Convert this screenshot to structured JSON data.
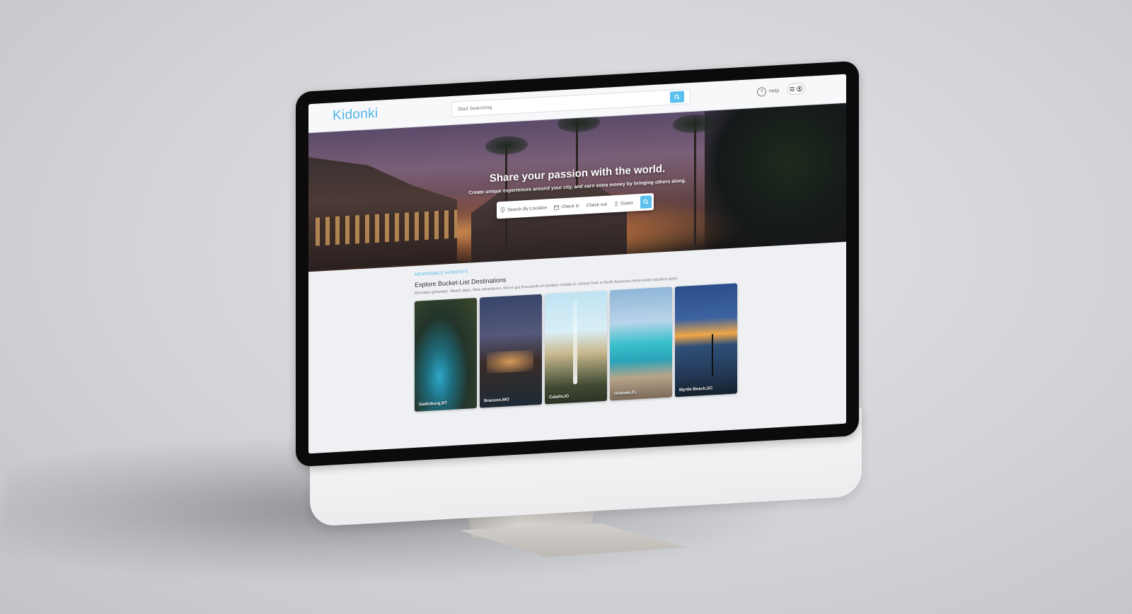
{
  "header": {
    "logo": "Kidonki",
    "search_placeholder": "Start Searching",
    "help_label": "Help"
  },
  "hero": {
    "title": "Share your passion with the world.",
    "subtitle": "Create unique experiences around your city, and earn extra money by bringing others along.",
    "search": {
      "location_placeholder": "Search By Location",
      "checkin_label": "Check in",
      "checkout_label": "Check out",
      "guest_label": "Guest"
    }
  },
  "section": {
    "eyebrow": "MEMORABLE MOMENTS",
    "title": "Explore Bucket-List Destinations",
    "description": "Mountain getaways. Beach days. New adventures. We've got thousands of vacation rentals to choose from in North America's most-loved vacation spots."
  },
  "destinations": [
    {
      "label": "Gatlinburg,NT"
    },
    {
      "label": "Branson,MO"
    },
    {
      "label": "Catalin,IO"
    },
    {
      "label": "Orlando,FL"
    },
    {
      "label": "Myrtle Beach,SC"
    }
  ],
  "colors": {
    "accent": "#4fb6e6",
    "button": "#5bc0ee"
  }
}
